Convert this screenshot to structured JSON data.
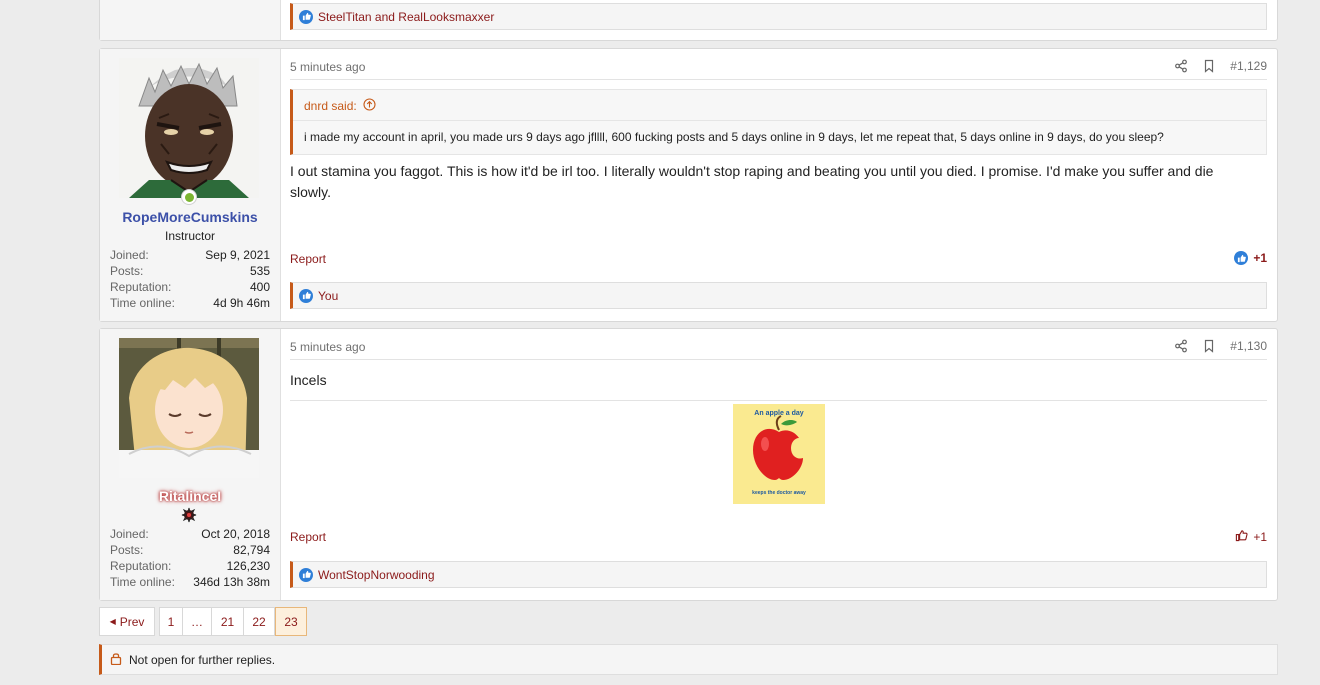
{
  "top_post": {
    "reactions": "SteelTitan and RealLooksmaxxer"
  },
  "posts": [
    {
      "user": {
        "name": "RopeMoreCumskins",
        "title": "Instructor",
        "stats": [
          {
            "label": "Joined:",
            "value": "Sep 9, 2021"
          },
          {
            "label": "Posts:",
            "value": "535"
          },
          {
            "label": "Reputation:",
            "value": "400"
          },
          {
            "label": "Time online:",
            "value": "4d 9h 46m"
          }
        ]
      },
      "time": "5 minutes ago",
      "number": "#1,129",
      "quote": {
        "author": "dnrd said:",
        "text": "i made my account in april, you made urs 9 days ago jfllll, 600 fucking posts and 5 days online in 9 days, let me repeat that, 5 days online in 9 days, do you sleep?"
      },
      "body": "I out stamina you faggot. This is how it'd be irl too. I literally wouldn't stop raping and beating you until you died. I promise. I'd make you suffer and die slowly.",
      "report": "Report",
      "reaction_count": "+1",
      "reactions": "You"
    },
    {
      "user": {
        "name": "RitalinceI",
        "stats": [
          {
            "label": "Joined:",
            "value": "Oct 20, 2018"
          },
          {
            "label": "Posts:",
            "value": "82,794"
          },
          {
            "label": "Reputation:",
            "value": "126,230"
          },
          {
            "label": "Time online:",
            "value": "346d 13h 38m"
          }
        ]
      },
      "time": "5 minutes ago",
      "number": "#1,130",
      "body": "Incels",
      "image": {
        "top_text": "An apple a day",
        "bottom_text": "keeps the doctor away"
      },
      "report": "Report",
      "reaction_count": "+1",
      "reactions": "WontStopNorwooding"
    }
  ],
  "pagination": {
    "prev": "Prev",
    "pages": [
      "1",
      "…",
      "21",
      "22",
      "23"
    ],
    "current": "23"
  },
  "notice": "Not open for further replies.",
  "colors": {
    "accent": "#c65a19",
    "link": "#8b1a1a",
    "username": "#3c50a8",
    "like": "#2f7fd8"
  }
}
